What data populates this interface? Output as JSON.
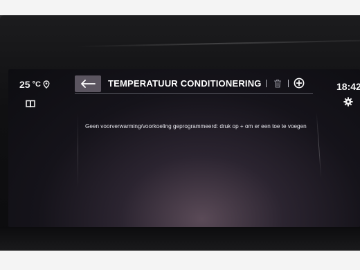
{
  "status": {
    "temperature": "25",
    "temperature_unit": "°C",
    "time": "18:42"
  },
  "header": {
    "title": "TEMPERATUUR CONDITIONERING"
  },
  "main": {
    "message": "Geen voorverwarming/voorkoeling geprogrammeerd: druk op + om er een toe te voegen"
  },
  "icons": {
    "location": "location-pin-icon",
    "book": "book-icon",
    "back": "back-arrow-icon",
    "trash": "trash-icon",
    "add": "add-circle-icon",
    "settings": "gear-icon"
  },
  "colors": {
    "accent_back_button": "#5b5560",
    "text": "#ffffff"
  }
}
